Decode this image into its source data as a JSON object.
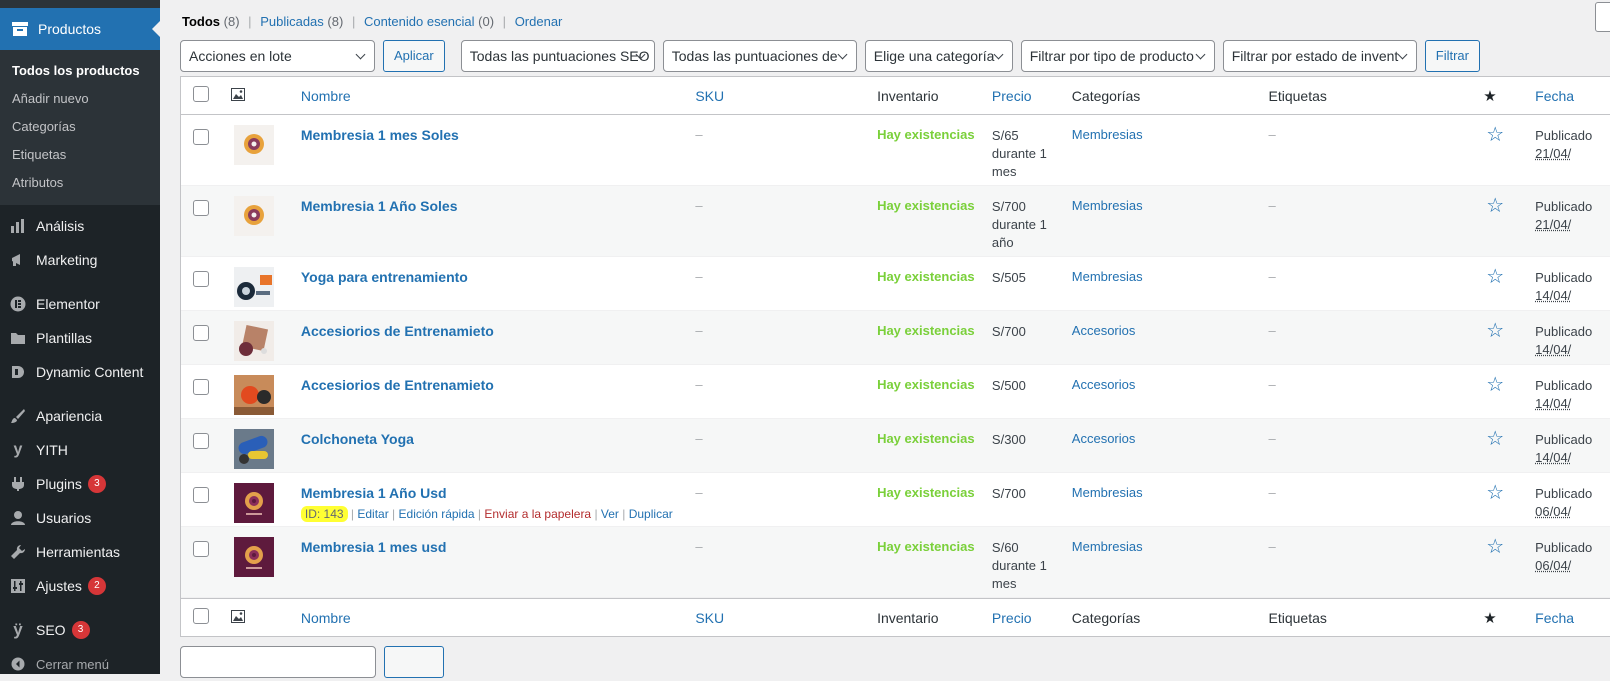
{
  "sidebar": {
    "products_label": "Productos",
    "submenu": [
      {
        "label": "Todos los productos",
        "current": true
      },
      {
        "label": "Añadir nuevo"
      },
      {
        "label": "Categorías"
      },
      {
        "label": "Etiquetas"
      },
      {
        "label": "Atributos"
      }
    ],
    "menu": {
      "analisis": "Análisis",
      "marketing": "Marketing",
      "elementor": "Elementor",
      "plantillas": "Plantillas",
      "dynamic": "Dynamic Content",
      "apariencia": "Apariencia",
      "yith": "YITH",
      "plugins": "Plugins",
      "plugins_badge": "3",
      "usuarios": "Usuarios",
      "herramientas": "Herramientas",
      "ajustes": "Ajustes",
      "ajustes_badge": "2",
      "seo": "SEO",
      "seo_badge": "3",
      "collapse": "Cerrar menú"
    }
  },
  "views": {
    "all": "Todos",
    "all_count": "(8)",
    "published": "Publicadas",
    "published_count": "(8)",
    "essential": "Contenido esencial",
    "essential_count": "(0)",
    "sort": "Ordenar"
  },
  "filters": {
    "bulk": "Acciones en lote",
    "apply": "Aplicar",
    "seo_scores": "Todas las puntuaciones SEO",
    "readability": "Todas las puntuaciones de",
    "category": "Elige una categoría",
    "product_type": "Filtrar por tipo de producto",
    "stock_status": "Filtrar por estado de invent",
    "filter": "Filtrar"
  },
  "columns": {
    "name": "Nombre",
    "sku": "SKU",
    "stock": "Inventario",
    "price": "Precio",
    "categories": "Categorías",
    "tags": "Etiquetas",
    "date": "Fecha"
  },
  "products": [
    {
      "name": "Membresia 1 mes Soles",
      "sku": "–",
      "stock": "Hay existencias",
      "price": [
        "S/65",
        "durante 1",
        "mes"
      ],
      "category": "Membresias",
      "tags": "–",
      "date": [
        "Publicado",
        "21/04/"
      ],
      "thumb": "donut-light"
    },
    {
      "name": "Membresia 1 Año Soles",
      "sku": "–",
      "stock": "Hay existencias",
      "price": [
        "S/700",
        "durante 1",
        "año"
      ],
      "category": "Membresias",
      "tags": "–",
      "date": [
        "Publicado",
        "21/04/"
      ],
      "thumb": "donut-light"
    },
    {
      "name": "Yoga para entrenamiento",
      "sku": "–",
      "stock": "Hay existencias",
      "price": [
        "S/505"
      ],
      "category": "Membresias",
      "tags": "–",
      "date": [
        "Publicado",
        "14/04/"
      ],
      "thumb": "yoga-gear"
    },
    {
      "name": "Accesiorios de Entrenamieto",
      "sku": "–",
      "stock": "Hay existencias",
      "price": [
        "S/700"
      ],
      "category": "Accesorios",
      "tags": "–",
      "date": [
        "Publicado",
        "14/04/"
      ],
      "thumb": "accessories-brown"
    },
    {
      "name": "Accesiorios de Entrenamieto",
      "sku": "–",
      "stock": "Hay existencias",
      "price": [
        "S/500"
      ],
      "category": "Accesorios",
      "tags": "–",
      "date": [
        "Publicado",
        "14/04/"
      ],
      "thumb": "accessories-orange"
    },
    {
      "name": "Colchoneta Yoga",
      "sku": "–",
      "stock": "Hay existencias",
      "price": [
        "S/300"
      ],
      "category": "Accesorios",
      "tags": "–",
      "date": [
        "Publicado",
        "14/04/"
      ],
      "thumb": "yoga-mat"
    },
    {
      "name": "Membresia 1 Año Usd",
      "sku": "–",
      "stock": "Hay existencias",
      "price": [
        "S/700"
      ],
      "category": "Membresias",
      "tags": "–",
      "date": [
        "Publicado",
        "06/04/"
      ],
      "thumb": "donut-dark",
      "actions": {
        "id": "ID: 143",
        "edit": "Editar",
        "quick": "Edición rápida",
        "trash": "Enviar a la papelera",
        "view": "Ver",
        "duplicate": "Duplicar"
      }
    },
    {
      "name": "Membresia 1 mes usd",
      "sku": "–",
      "stock": "Hay existencias",
      "price": [
        "S/60",
        "durante 1",
        "mes"
      ],
      "category": "Membresias",
      "tags": "–",
      "date": [
        "Publicado",
        "06/04/"
      ],
      "thumb": "donut-dark"
    }
  ],
  "colors": {
    "accent": "#2271b1",
    "sidebar": "#1d2327",
    "instock": "#7ad03a",
    "trash": "#b32d2e",
    "highlight": "#ffff33"
  }
}
